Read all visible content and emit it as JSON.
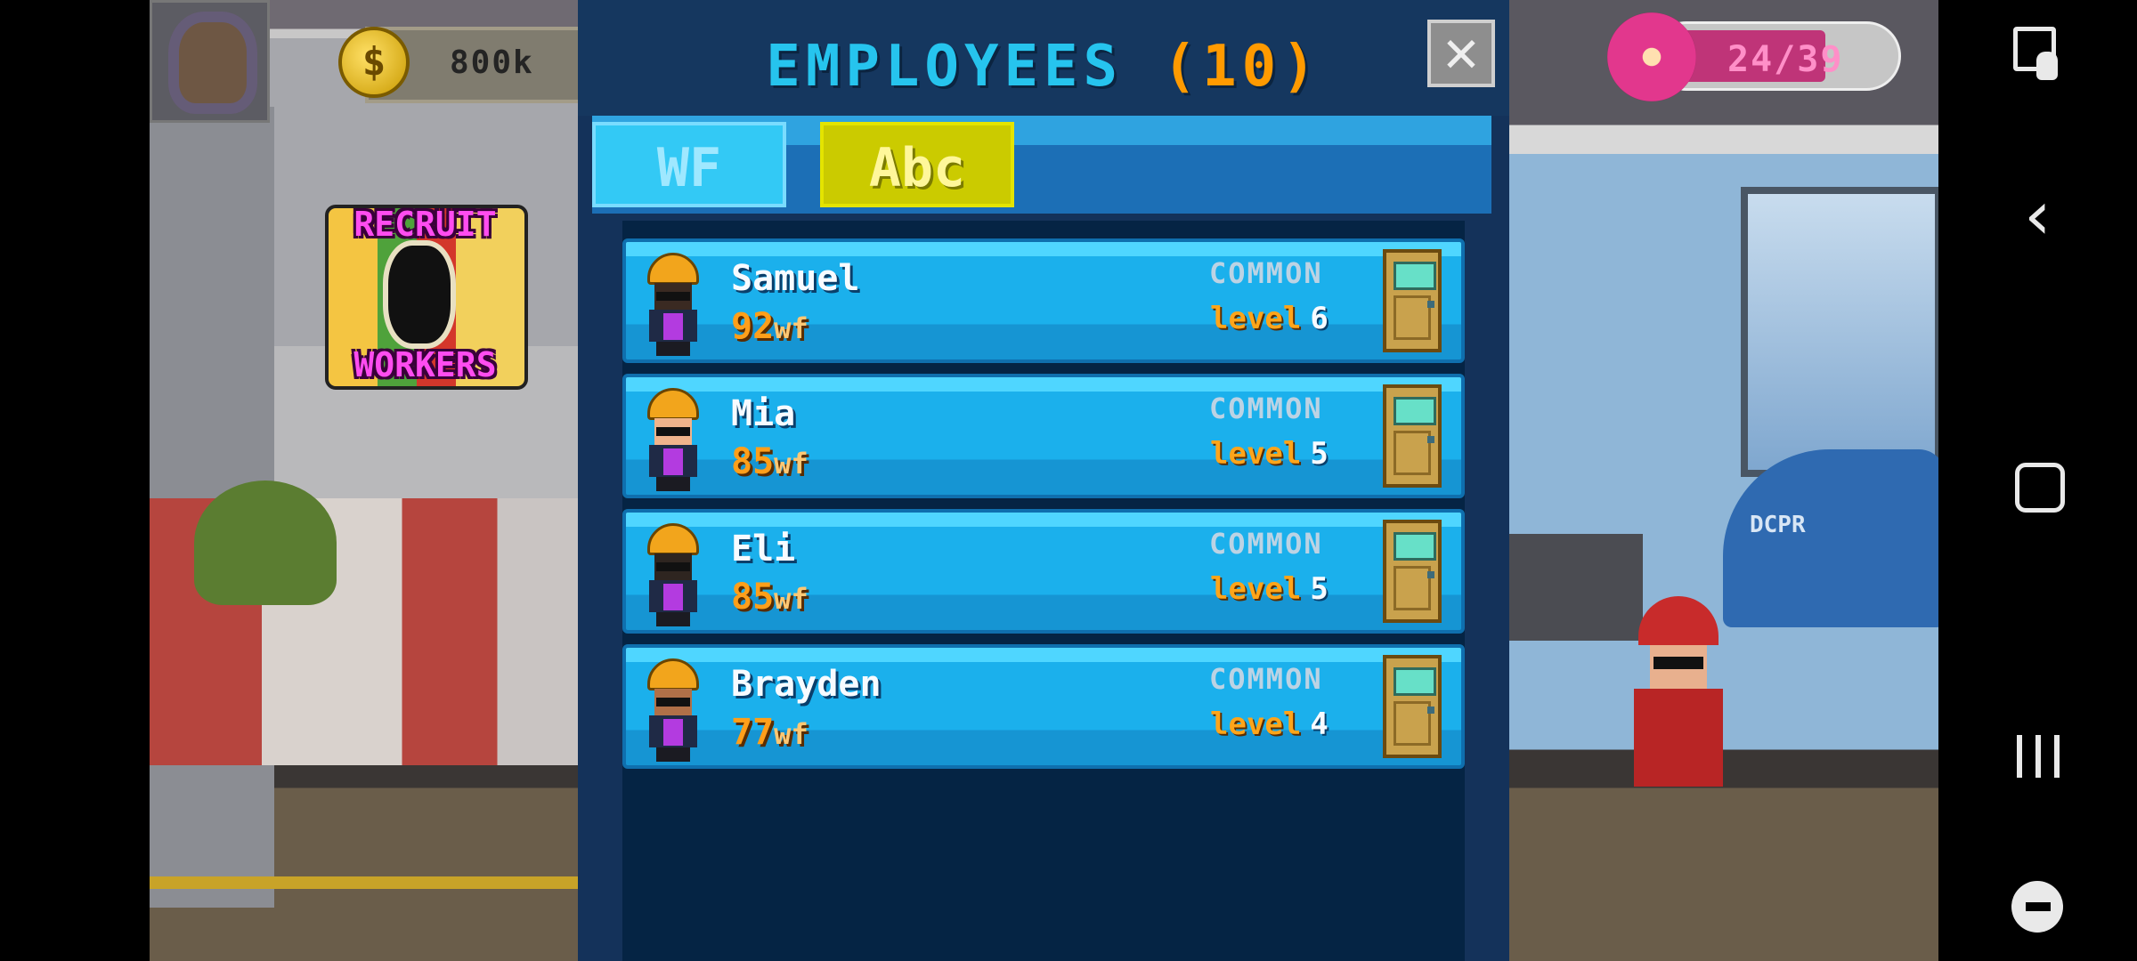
{
  "hud": {
    "money": "800k",
    "donuts": "24/39",
    "recruit_top": "RECRUIT",
    "recruit_bottom": "WORKERS"
  },
  "dialog": {
    "title": "EMPLOYEES",
    "count": "(10)",
    "close_label": "✕",
    "tabs": [
      "WF",
      "Abc"
    ]
  },
  "employees": [
    {
      "name": "Samuel",
      "wf": "92",
      "wf_unit": "wf",
      "rarity": "COMMON",
      "level_label": "level",
      "level": "6"
    },
    {
      "name": "Mia",
      "wf": "85",
      "wf_unit": "wf",
      "rarity": "COMMON",
      "level_label": "level",
      "level": "5"
    },
    {
      "name": "Eli",
      "wf": "85",
      "wf_unit": "wf",
      "rarity": "COMMON",
      "level_label": "level",
      "level": "5"
    },
    {
      "name": "Brayden",
      "wf": "77",
      "wf_unit": "wf",
      "rarity": "COMMON",
      "level_label": "level",
      "level": "4"
    }
  ],
  "scene": {
    "car_text": "DCPR"
  },
  "colors": {
    "dialog_bg": "#14325a",
    "title_blue": "#26c4ee",
    "title_orange": "#ff9a00",
    "row_blue": "#1bb0ec",
    "tab_active": "#33c9f5",
    "tab_inactive": "#cbcb00"
  },
  "icons": {
    "money": "coin-icon",
    "donuts": "donut-icon",
    "close": "close-icon",
    "door": "door-icon",
    "nav": [
      "screenshot-icon",
      "back-icon",
      "home-icon",
      "recent-apps-icon",
      "game-tools-icon"
    ]
  }
}
